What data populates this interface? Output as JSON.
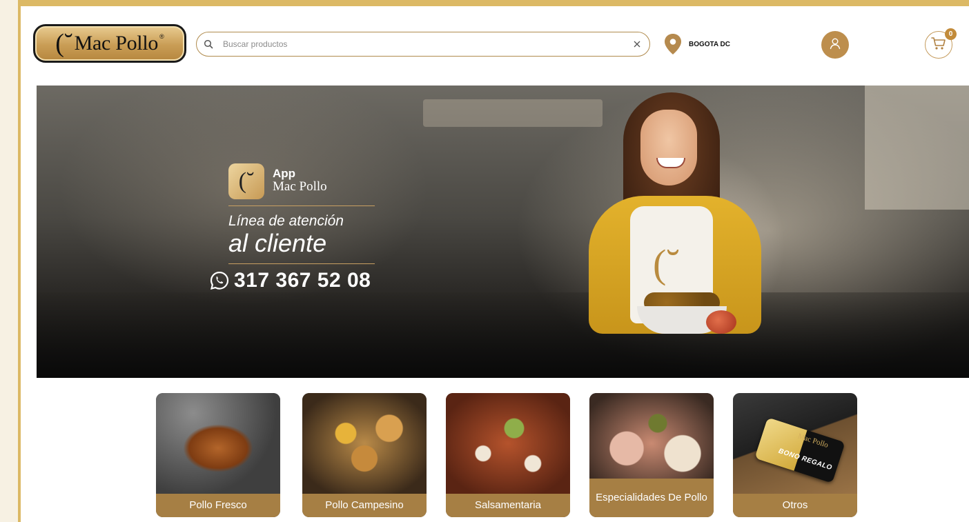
{
  "header": {
    "logo_text": "Mac Pollo",
    "logo_registered": "®",
    "search_placeholder": "Buscar productos",
    "search_value": "",
    "location_label": "BOGOTA DC",
    "cart_count": "0"
  },
  "banner": {
    "app_title": "App",
    "app_subtitle": "Mac Pollo",
    "line1": "Línea de atención",
    "line2": "al cliente",
    "phone": "317 367 52 08",
    "apron_logo_text": "(˘"
  },
  "categories": [
    {
      "label": "Pollo Fresco"
    },
    {
      "label": "Pollo Campesino"
    },
    {
      "label": "Salsamentaria"
    },
    {
      "label": "Especialidades De Pollo"
    },
    {
      "label": "Otros"
    }
  ],
  "giftcard": {
    "brand": "Mac Pollo",
    "text": "BONO REGALO"
  },
  "colors": {
    "frame_gold": "#dcb965",
    "brand_gold": "#bd8e4d",
    "category_label_bg": "#a67f44"
  },
  "icons": [
    "search-icon",
    "clear-icon",
    "location-pin-icon",
    "user-icon",
    "cart-icon",
    "whatsapp-icon"
  ]
}
